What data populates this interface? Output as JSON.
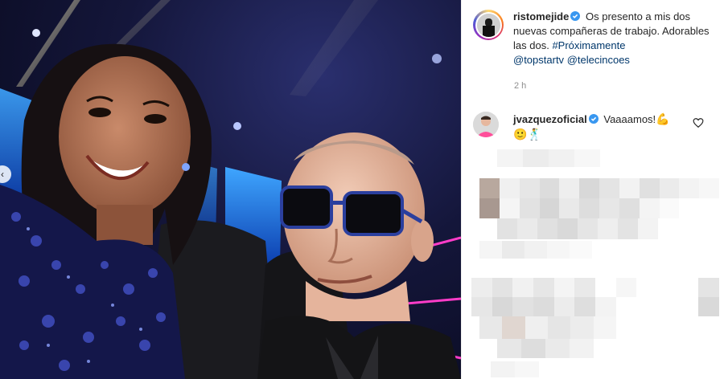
{
  "post": {
    "author": {
      "username": "ristomejide",
      "verified": true,
      "avatar_icon": "profile-photo-icon"
    },
    "caption": {
      "text": "Os presento a mis dos nuevas compañeras de trabajo. Adorables las dos.",
      "hashtag": "#Próximamente",
      "mention_1": "@topstartv",
      "mention_2": "@telecincoes"
    },
    "time": "2 h",
    "carousel_prev_icon": "chevron-left-icon"
  },
  "comments": [
    {
      "username": "jvazquezoficial",
      "verified": true,
      "text": "Vaaaamos!",
      "emoji_1": "💪",
      "emoji_2": "🙂",
      "emoji_3": "🕺",
      "like_icon": "heart-icon"
    }
  ],
  "colors": {
    "link": "#00376b",
    "text": "#262626",
    "secondary": "#8e8e8e",
    "verified": "#3897f0"
  }
}
